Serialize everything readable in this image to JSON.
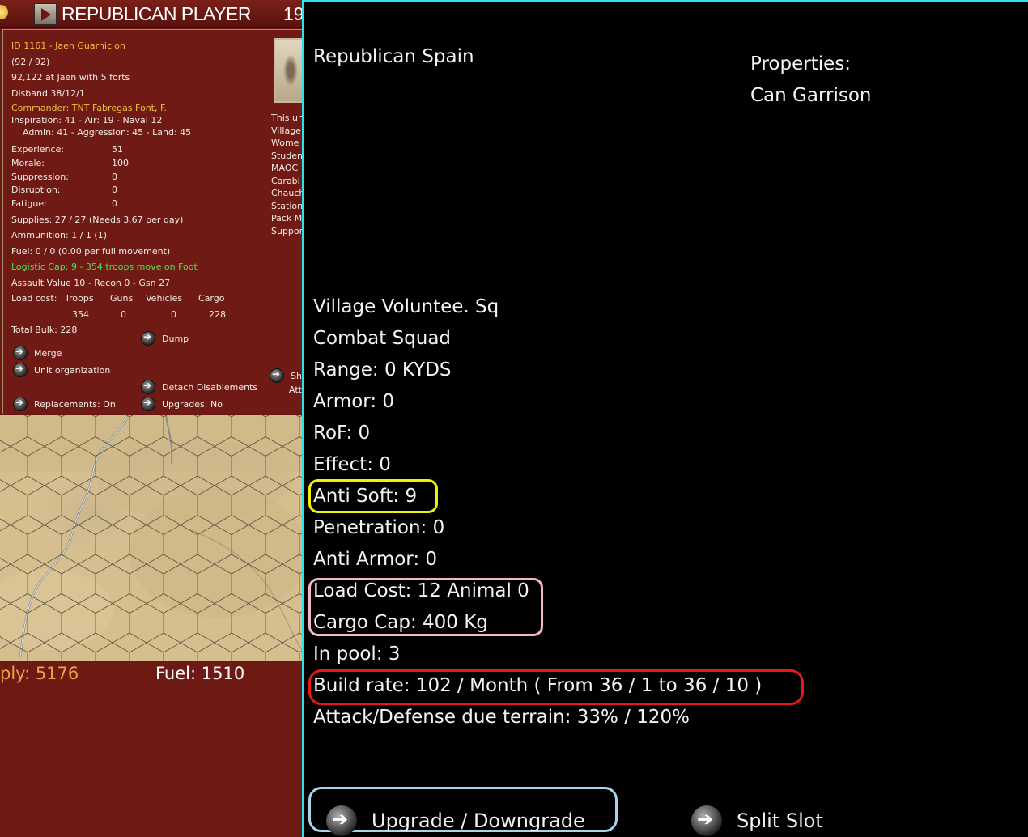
{
  "header": {
    "title": "REPUBLICAN PLAYER",
    "year_fragment": "19"
  },
  "unit": {
    "id_line": "ID 1161 - Jaen Guarnicion",
    "strength": "(92 / 92)",
    "location": "92,122 at Jaen with 5 forts",
    "disband": "Disband 38/12/1",
    "commander": "Commander: TNT Fabregas Font, F.",
    "inspiration": "Inspiration: 41 - Air: 19 - Naval 12",
    "admin": "Admin: 41 - Aggression: 45 - Land: 45",
    "stats": [
      {
        "label": "Experience:",
        "value": "51"
      },
      {
        "label": "Morale:",
        "value": "100"
      },
      {
        "label": "Suppression:",
        "value": "0"
      },
      {
        "label": "Disruption:",
        "value": "0"
      },
      {
        "label": "Fatigue:",
        "value": "0"
      }
    ],
    "supplies": "Supplies: 27 / 27 (Needs 3.67 per day)",
    "ammunition": "Ammunition: 1 / 1 (1)",
    "fuel": "Fuel: 0 / 0 (0.00 per full movement)",
    "logistic": "Logistic Cap: 9 - 354 troops move on Foot",
    "assault": "Assault Value 10 - Recon 0 - Gsn 27",
    "load_cost_label": "Load cost:",
    "load_headers": [
      "Troops",
      "Guns",
      "Vehicles",
      "Cargo"
    ],
    "load_values": [
      "354",
      "0",
      "0",
      "228"
    ],
    "total_bulk": "Total Bulk: 228",
    "portrait_lines": [
      "This un",
      "Village",
      "Wome",
      "Studen",
      "MAOC",
      "Carabi",
      "Chauch",
      "Station",
      "Pack M",
      "Suppor"
    ],
    "actions": {
      "dump": "Dump",
      "merge": "Merge",
      "unit_org": "Unit organization",
      "detach": "Detach Disablements",
      "replacements": "Replacements: On",
      "upgrades": "Upgrades: No",
      "show": "Sh",
      "att": "Att"
    }
  },
  "bottom": {
    "supply": "ply: 5176",
    "fuel": "Fuel: 1510"
  },
  "detail": {
    "nation": "Republican Spain",
    "properties_label": "Properties:",
    "property": "Can Garrison",
    "name": "Village Voluntee. Sq",
    "type": "Combat Squad",
    "range": "Range: 0 KYDS",
    "armor": "Armor: 0",
    "rof": "RoF: 0",
    "effect": "Effect: 0",
    "anti_soft": "Anti Soft: 9",
    "penetration": "Penetration: 0",
    "anti_armor": "Anti Armor: 0",
    "load_cost": "Load Cost: 12 Animal 0",
    "cargo_cap": "Cargo Cap: 400 Kg",
    "in_pool": "In pool: 3",
    "build_rate": "Build rate: 102 / Month ( From 36 / 1 to 36 / 10 )",
    "attack_defense": "Attack/Defense due terrain: 33% / 120%",
    "upgrade_btn": "Upgrade / Downgrade",
    "split_btn": "Split Slot"
  },
  "colors": {
    "panel_red": "#6f1a15",
    "highlight_yellow": "#f2f200",
    "highlight_pink": "#f7b6c6",
    "highlight_red": "#e81818",
    "highlight_blue": "#a8d4ea",
    "frame_cyan": "#2ee0e8"
  }
}
